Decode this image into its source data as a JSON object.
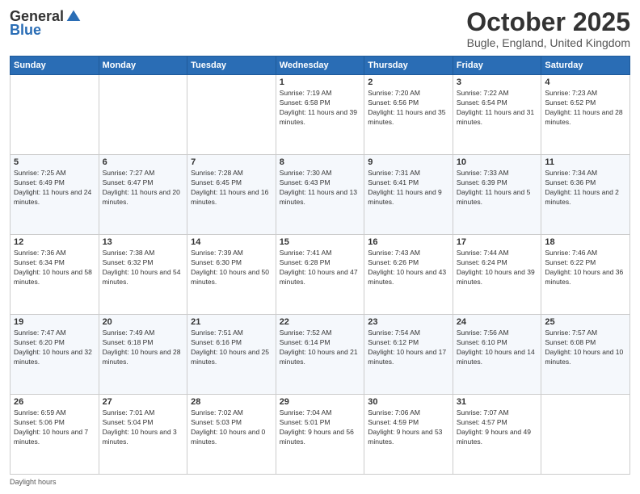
{
  "header": {
    "logo_general": "General",
    "logo_blue": "Blue",
    "month": "October 2025",
    "location": "Bugle, England, United Kingdom"
  },
  "weekdays": [
    "Sunday",
    "Monday",
    "Tuesday",
    "Wednesday",
    "Thursday",
    "Friday",
    "Saturday"
  ],
  "weeks": [
    [
      null,
      null,
      null,
      {
        "day": 1,
        "sunrise": "7:19 AM",
        "sunset": "6:58 PM",
        "daylight": "11 hours and 39 minutes."
      },
      {
        "day": 2,
        "sunrise": "7:20 AM",
        "sunset": "6:56 PM",
        "daylight": "11 hours and 35 minutes."
      },
      {
        "day": 3,
        "sunrise": "7:22 AM",
        "sunset": "6:54 PM",
        "daylight": "11 hours and 31 minutes."
      },
      {
        "day": 4,
        "sunrise": "7:23 AM",
        "sunset": "6:52 PM",
        "daylight": "11 hours and 28 minutes."
      }
    ],
    [
      {
        "day": 5,
        "sunrise": "7:25 AM",
        "sunset": "6:49 PM",
        "daylight": "11 hours and 24 minutes."
      },
      {
        "day": 6,
        "sunrise": "7:27 AM",
        "sunset": "6:47 PM",
        "daylight": "11 hours and 20 minutes."
      },
      {
        "day": 7,
        "sunrise": "7:28 AM",
        "sunset": "6:45 PM",
        "daylight": "11 hours and 16 minutes."
      },
      {
        "day": 8,
        "sunrise": "7:30 AM",
        "sunset": "6:43 PM",
        "daylight": "11 hours and 13 minutes."
      },
      {
        "day": 9,
        "sunrise": "7:31 AM",
        "sunset": "6:41 PM",
        "daylight": "11 hours and 9 minutes."
      },
      {
        "day": 10,
        "sunrise": "7:33 AM",
        "sunset": "6:39 PM",
        "daylight": "11 hours and 5 minutes."
      },
      {
        "day": 11,
        "sunrise": "7:34 AM",
        "sunset": "6:36 PM",
        "daylight": "11 hours and 2 minutes."
      }
    ],
    [
      {
        "day": 12,
        "sunrise": "7:36 AM",
        "sunset": "6:34 PM",
        "daylight": "10 hours and 58 minutes."
      },
      {
        "day": 13,
        "sunrise": "7:38 AM",
        "sunset": "6:32 PM",
        "daylight": "10 hours and 54 minutes."
      },
      {
        "day": 14,
        "sunrise": "7:39 AM",
        "sunset": "6:30 PM",
        "daylight": "10 hours and 50 minutes."
      },
      {
        "day": 15,
        "sunrise": "7:41 AM",
        "sunset": "6:28 PM",
        "daylight": "10 hours and 47 minutes."
      },
      {
        "day": 16,
        "sunrise": "7:43 AM",
        "sunset": "6:26 PM",
        "daylight": "10 hours and 43 minutes."
      },
      {
        "day": 17,
        "sunrise": "7:44 AM",
        "sunset": "6:24 PM",
        "daylight": "10 hours and 39 minutes."
      },
      {
        "day": 18,
        "sunrise": "7:46 AM",
        "sunset": "6:22 PM",
        "daylight": "10 hours and 36 minutes."
      }
    ],
    [
      {
        "day": 19,
        "sunrise": "7:47 AM",
        "sunset": "6:20 PM",
        "daylight": "10 hours and 32 minutes."
      },
      {
        "day": 20,
        "sunrise": "7:49 AM",
        "sunset": "6:18 PM",
        "daylight": "10 hours and 28 minutes."
      },
      {
        "day": 21,
        "sunrise": "7:51 AM",
        "sunset": "6:16 PM",
        "daylight": "10 hours and 25 minutes."
      },
      {
        "day": 22,
        "sunrise": "7:52 AM",
        "sunset": "6:14 PM",
        "daylight": "10 hours and 21 minutes."
      },
      {
        "day": 23,
        "sunrise": "7:54 AM",
        "sunset": "6:12 PM",
        "daylight": "10 hours and 17 minutes."
      },
      {
        "day": 24,
        "sunrise": "7:56 AM",
        "sunset": "6:10 PM",
        "daylight": "10 hours and 14 minutes."
      },
      {
        "day": 25,
        "sunrise": "7:57 AM",
        "sunset": "6:08 PM",
        "daylight": "10 hours and 10 minutes."
      }
    ],
    [
      {
        "day": 26,
        "sunrise": "6:59 AM",
        "sunset": "5:06 PM",
        "daylight": "10 hours and 7 minutes."
      },
      {
        "day": 27,
        "sunrise": "7:01 AM",
        "sunset": "5:04 PM",
        "daylight": "10 hours and 3 minutes."
      },
      {
        "day": 28,
        "sunrise": "7:02 AM",
        "sunset": "5:03 PM",
        "daylight": "10 hours and 0 minutes."
      },
      {
        "day": 29,
        "sunrise": "7:04 AM",
        "sunset": "5:01 PM",
        "daylight": "9 hours and 56 minutes."
      },
      {
        "day": 30,
        "sunrise": "7:06 AM",
        "sunset": "4:59 PM",
        "daylight": "9 hours and 53 minutes."
      },
      {
        "day": 31,
        "sunrise": "7:07 AM",
        "sunset": "4:57 PM",
        "daylight": "9 hours and 49 minutes."
      },
      null
    ]
  ],
  "footer": {
    "note": "Daylight hours"
  }
}
